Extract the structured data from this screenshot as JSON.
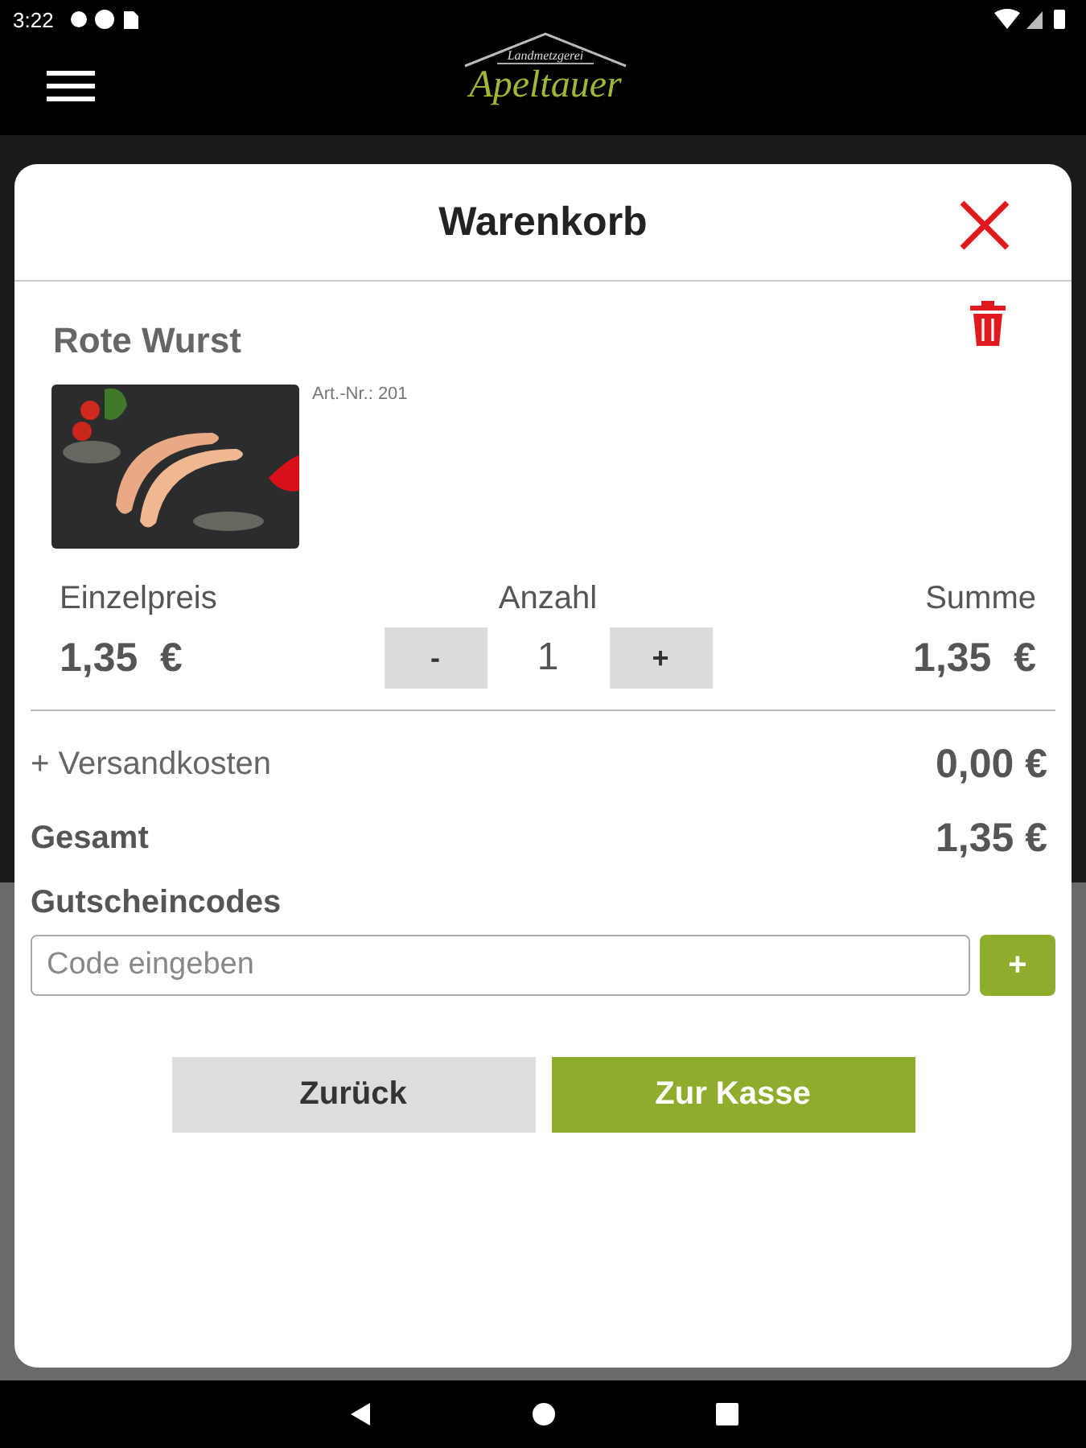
{
  "status_bar": {
    "time": "3:22"
  },
  "header": {
    "logo_small": "Landmetzgerei",
    "logo_name": "Apeltauer"
  },
  "cart": {
    "title": "Warenkorb",
    "item": {
      "name": "Rote Wurst",
      "article_no": "Art.-Nr.: 201",
      "unit_price_label": "Einzelpreis",
      "quantity_label": "Anzahl",
      "sum_label": "Summe",
      "unit_price": "1,35  €",
      "decrement": "-",
      "quantity": "1",
      "increment": "+",
      "sum": "1,35  €"
    },
    "shipping_label": "+ Versandkosten",
    "shipping": "0,00 €",
    "total_label": "Gesamt",
    "total": "1,35 €",
    "coupon": {
      "label": "Gutscheincodes",
      "placeholder": "Code eingeben",
      "add": "+"
    },
    "buttons": [
      {
        "label": "Zurück",
        "kind": "secondary"
      },
      {
        "label": "Zur Kasse",
        "kind": "primary"
      }
    ]
  }
}
